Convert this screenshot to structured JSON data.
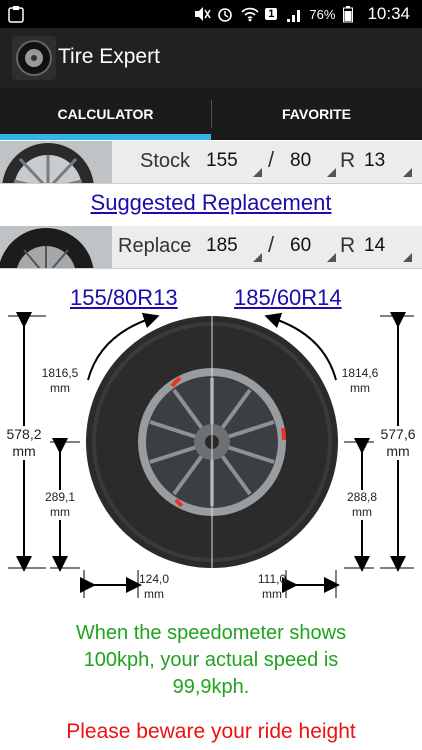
{
  "status": {
    "battery": "76%",
    "time": "10:34",
    "sim": "1"
  },
  "app": {
    "title": "Tire Expert"
  },
  "tabs": [
    {
      "label": "CALCULATOR"
    },
    {
      "label": "FAVORITE"
    }
  ],
  "stock": {
    "label": "Stock",
    "width": "155",
    "ratio": "80",
    "r": "R",
    "rim": "13"
  },
  "suggest": {
    "text": "Suggested Replacement"
  },
  "replace": {
    "label": "Replace",
    "width": "185",
    "ratio": "60",
    "r": "R",
    "rim": "14"
  },
  "sizes": {
    "stock": "155/80R13",
    "replace": "185/60R14"
  },
  "dims": {
    "circ_left": [
      "1816,5",
      "mm"
    ],
    "circ_right": [
      "1814,6",
      "mm"
    ],
    "height_left": [
      "578,2",
      "mm"
    ],
    "height_right": [
      "577,6",
      "mm"
    ],
    "radius_left": [
      "289,1",
      "mm"
    ],
    "radius_right": [
      "288,8",
      "mm"
    ],
    "width_left": [
      "124,0",
      "mm"
    ],
    "width_right": [
      "111,0",
      "mm"
    ]
  },
  "speed": {
    "line1": "When the speedometer shows",
    "line2": "100kph, your actual speed is",
    "line3": "99,9kph."
  },
  "warning": {
    "line1": "Please beware your ride height"
  },
  "colors": {
    "tab_indicator": "#33b5e5",
    "speed_text": "#1fa31f",
    "warning_text": "#ee1111",
    "link": "#1a0dab"
  }
}
